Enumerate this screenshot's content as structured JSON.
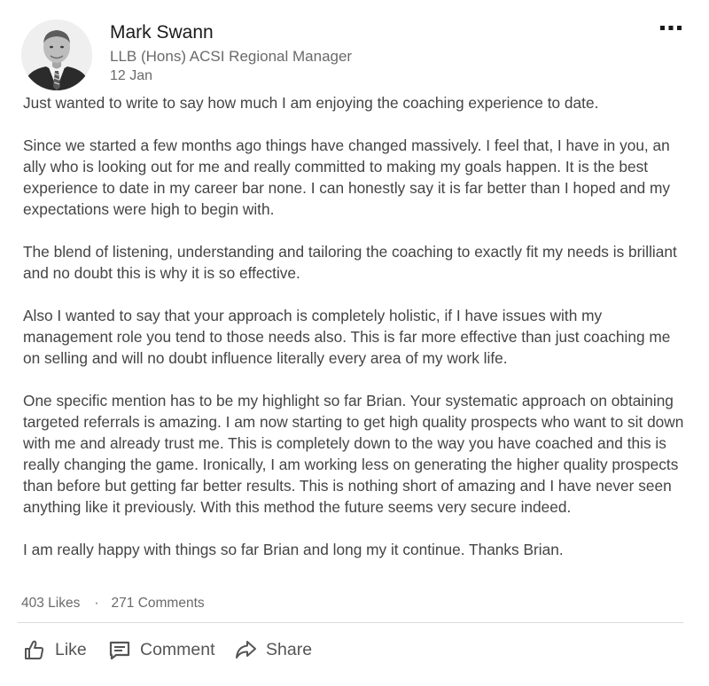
{
  "post": {
    "author": {
      "name": "Mark Swann",
      "title": "LLB (Hons) ACSI Regional Manager",
      "date": "12 Jan"
    },
    "paragraphs": [
      "Just wanted to write to say how much I am enjoying the coaching experience to date.",
      "Since we started a few months ago things have changed massively. I feel that, I have in you, an ally who is looking out for me and really committed to making my goals happen. It is the best experience to date in my career bar none. I can honestly say it is far better than I hoped and my expectations were high to begin with.",
      "The blend of listening, understanding and tailoring the coaching to exactly fit my needs is brilliant and no doubt this is why it is so effective.",
      "Also I wanted to say that your approach is completely holistic, if I have issues with my management role you tend to those needs also. This is far more effective than just coaching me on selling and will no doubt influence literally every area of my work life.",
      "One specific mention has to be my highlight so far Brian. Your systematic approach on obtaining targeted referrals is amazing. I am now starting to get high quality prospects who want to sit down with me and already trust me. This is completely down to the way you have coached and this is really changing the game. Ironically, I am working less on generating the higher quality prospects than before but getting far better results. This is nothing short of amazing and I have never seen anything like it previously. With this method the future seems very secure indeed.",
      "I am really happy with things so far Brian and long my it continue. Thanks Brian."
    ],
    "stats": {
      "likes": "403 Likes",
      "separator": "·",
      "comments": "271 Comments"
    },
    "actions": {
      "like": "Like",
      "comment": "Comment",
      "share": "Share"
    },
    "icons": {
      "more": "more-options-icon",
      "like": "thumbs-up-icon",
      "comment": "comment-icon",
      "share": "share-arrow-icon",
      "avatar": "profile-photo"
    }
  }
}
